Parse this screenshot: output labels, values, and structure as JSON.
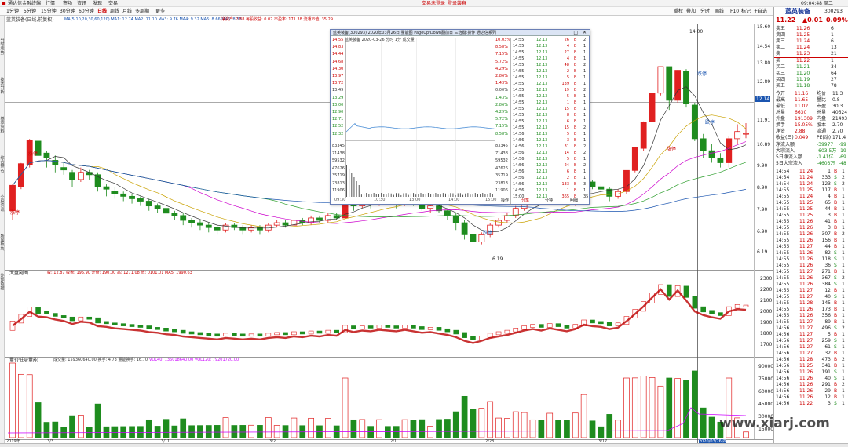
{
  "app": {
    "title": "通达信金融终端",
    "menus": [
      "行情",
      "市场",
      "资讯",
      "发现",
      "交易"
    ],
    "notice": "交易未登录",
    "account": "登录装备",
    "clock": "09:04:48 周二"
  },
  "toolbar": {
    "period_tabs": [
      "1分钟",
      "5分钟",
      "15分钟",
      "30分钟",
      "60分钟",
      "日线",
      "周线",
      "月线",
      "多周期",
      "更多"
    ],
    "active": "日线",
    "right_tabs": [
      "重权",
      "叠加",
      "分时",
      "画线",
      "F10",
      "标记",
      "+自选",
      "返回"
    ]
  },
  "side_tabs": [
    "分时走势",
    "技术分析",
    "基本资料",
    "综合排名",
    "个股资讯",
    "所属板块",
    "外部数据"
  ],
  "chart_header": {
    "name": "蓝英装备(日线,前复权)",
    "ma": "MA(5,10,20,30,60,120) MA1: 12.74 MA2: 11.10 MA3: 9.76 MA4: 9.32 MA5: 8.66 MA6: 8.33",
    "extra": "净资产: 2.88 每股收益: 0.07 市盈率: 171.38 流通市值: 35.29"
  },
  "indicator_header": {
    "name": "大盘副图",
    "vals": "收: 12.87 收盘: 195.90 开盘: 190.00 高: 1271.08 低: 0101.01 MA5: 1990.63"
  },
  "volume_header": {
    "name": "量价低吸量能",
    "vals": "成交量: 159360640.00 换手: 4.73 量能换手: 16.70",
    "ma": "VOL40: 136018640.00 VOL120: 79201720.00"
  },
  "labels": {
    "zt": "涨停",
    "dt": "跌停",
    "high": "14.00",
    "low": "6.19"
  },
  "price_axis": [
    "15.60",
    "14.54",
    "13.80",
    "12.89",
    "11.91",
    "10.89",
    "9.90",
    "8.90",
    "7.90",
    "6.90",
    "6.19"
  ],
  "ind_axis": [
    "2300",
    "2200",
    "2100",
    "2000",
    "1900",
    "1800",
    "1700"
  ],
  "vol_axis": [
    "90000",
    "75000",
    "60000",
    "45000",
    "30000",
    "15000"
  ],
  "date_axis": [
    "2019年",
    "3/3",
    "3/11",
    "3/2",
    "2/1",
    "2/28",
    "3/17",
    "2020/03/26 四"
  ],
  "cursor_price": "12.14",
  "popup": {
    "title": "蓝英装备(300293) 2020年03月26日 量能图 PageUp/Down翻前日 三倍键:操作 通达信系列",
    "sub": "蓝英装备  2020-03-26 分时 1分 成交量",
    "left_scale": [
      "14.55",
      "14.83",
      "14.44",
      "14.68",
      "14.30",
      "13.97",
      "13.72",
      "13.49",
      "13.29",
      "13.00",
      "12.90",
      "12.71",
      "12.52",
      "12.32"
    ],
    "right_scale": [
      "10.03%",
      "8.58%",
      "7.15%",
      "5.72%",
      "4.29%",
      "2.86%",
      "1.43%",
      "0.00%",
      "1.43%",
      "2.86%",
      "4.29%",
      "5.72%",
      "7.15%",
      "8.58%"
    ],
    "vol_scale": [
      "83345",
      "71438",
      "59532",
      "47626",
      "35719",
      "23813",
      "11906"
    ],
    "time_axis": [
      "09:30",
      "10:30",
      "13:00",
      "14:00",
      "15:00"
    ],
    "tabs": [
      "操作",
      "分笔",
      "分钟",
      "明细"
    ],
    "ticks": [
      [
        "14:55",
        "12.13",
        "26",
        "B",
        "2"
      ],
      [
        "14:55",
        "12.13",
        "4",
        "B",
        "1"
      ],
      [
        "14:55",
        "12.13",
        "27",
        "B",
        "1"
      ],
      [
        "14:55",
        "12.13",
        "4",
        "B",
        "1"
      ],
      [
        "14:55",
        "12.13",
        "48",
        "B",
        "2"
      ],
      [
        "14:55",
        "12.13",
        "2",
        "B",
        "1"
      ],
      [
        "14:55",
        "12.13",
        "5",
        "B",
        "1"
      ],
      [
        "14:55",
        "12.13",
        "139",
        "B",
        "1"
      ],
      [
        "14:55",
        "12.13",
        "19",
        "B",
        "2"
      ],
      [
        "14:55",
        "12.13",
        "5",
        "B",
        "1"
      ],
      [
        "14:55",
        "12.13",
        "1",
        "B",
        "1"
      ],
      [
        "14:55",
        "12.13",
        "15",
        "B",
        "1"
      ],
      [
        "14:55",
        "12.13",
        "8",
        "B",
        "1"
      ],
      [
        "14:55",
        "12.13",
        "6",
        "B",
        "1"
      ],
      [
        "14:55",
        "12.13",
        "15",
        "B",
        "2"
      ],
      [
        "14:56",
        "12.13",
        "5",
        "B",
        "1"
      ],
      [
        "14:56",
        "12.13",
        "3",
        "B",
        "1"
      ],
      [
        "14:56",
        "12.13",
        "31",
        "B",
        "2"
      ],
      [
        "14:56",
        "12.13",
        "14",
        "B",
        "2"
      ],
      [
        "14:56",
        "12.13",
        "5",
        "B",
        "1"
      ],
      [
        "14:56",
        "12.13",
        "24",
        "B",
        "2"
      ],
      [
        "14:56",
        "12.13",
        "6",
        "B",
        "1"
      ],
      [
        "14:56",
        "12.13",
        "2",
        "B",
        "1"
      ],
      [
        "14:56",
        "12.13",
        "133",
        "B",
        "3"
      ],
      [
        "14:56",
        "12.13",
        "1",
        "B",
        "1"
      ],
      [
        "15:00",
        "12.13",
        "365",
        "B",
        "35"
      ]
    ]
  },
  "stock": {
    "name": "蓝英装备",
    "code": "300293",
    "price": "11.22",
    "change": "▲0.01",
    "pct": "0.09%",
    "asks": [
      [
        "卖五",
        "11.26",
        "6"
      ],
      [
        "卖四",
        "11.25",
        "1"
      ],
      [
        "卖三",
        "11.24",
        "6"
      ],
      [
        "卖二",
        "11.24",
        "13"
      ],
      [
        "卖一",
        "11.23",
        "21"
      ]
    ],
    "bids": [
      [
        "买一",
        "11.22",
        "1"
      ],
      [
        "买二",
        "11.21",
        "34"
      ],
      [
        "买三",
        "11.20",
        "64"
      ],
      [
        "买四",
        "11.19",
        "27"
      ],
      [
        "买五",
        "11.18",
        "78"
      ]
    ],
    "stats": [
      [
        "今开",
        "11.16",
        "均价",
        "11.3"
      ],
      [
        "最高",
        "11.65",
        "量比",
        "0.8"
      ],
      [
        "最低",
        "11.02",
        "市盈",
        "30.3"
      ],
      [
        "总量",
        "6630",
        "总量",
        "40624"
      ],
      [
        "外盘",
        "191309",
        "内盘",
        "21493"
      ],
      [
        "换手",
        "15.05%",
        "股本",
        "2.70"
      ],
      [
        "净资",
        "2.88",
        "流通",
        "2.70"
      ],
      [
        "收益(三)",
        "0.049",
        "PE(动)",
        "171.4"
      ]
    ],
    "flows": [
      [
        "净流入额",
        "-39977",
        "-99"
      ],
      [
        "大宗流入",
        "-603.5万",
        "-19"
      ],
      [
        "5日净流入额",
        "-1.41亿",
        "-69"
      ],
      [
        "5日大宗流入",
        "-4603万",
        "-48"
      ]
    ]
  },
  "trades": [
    [
      "14:54",
      "11.24",
      "1",
      "B",
      "1"
    ],
    [
      "14:54",
      "11.24",
      "333",
      "S",
      "2"
    ],
    [
      "14:54",
      "11.24",
      "123",
      "S",
      "2"
    ],
    [
      "14:55",
      "11.25",
      "117",
      "B",
      "1"
    ],
    [
      "14:55",
      "11.24",
      "4",
      "B",
      "1"
    ],
    [
      "14:55",
      "11.25",
      "65",
      "B",
      "1"
    ],
    [
      "14:55",
      "11.25",
      "44",
      "B",
      "1"
    ],
    [
      "14:55",
      "11.25",
      "3",
      "B",
      "1"
    ],
    [
      "14:55",
      "11.26",
      "41",
      "B",
      "1"
    ],
    [
      "14:55",
      "11.26",
      "3",
      "B",
      "1"
    ],
    [
      "14:55",
      "11.26",
      "307",
      "B",
      "2"
    ],
    [
      "14:55",
      "11.26",
      "156",
      "B",
      "1"
    ],
    [
      "14:55",
      "11.27",
      "44",
      "B",
      "1"
    ],
    [
      "14:55",
      "11.26",
      "82",
      "S",
      "1"
    ],
    [
      "14:55",
      "11.26",
      "118",
      "S",
      "1"
    ],
    [
      "14:55",
      "11.26",
      "36",
      "S",
      "1"
    ],
    [
      "14:55",
      "11.27",
      "271",
      "B",
      "1"
    ],
    [
      "14:55",
      "11.26",
      "367",
      "S",
      "2"
    ],
    [
      "14:55",
      "11.26",
      "384",
      "S",
      "1"
    ],
    [
      "14:55",
      "11.27",
      "12",
      "B",
      "1"
    ],
    [
      "14:55",
      "11.27",
      "40",
      "S",
      "1"
    ],
    [
      "14:55",
      "11.28",
      "145",
      "B",
      "1"
    ],
    [
      "14:55",
      "11.26",
      "173",
      "B",
      "1"
    ],
    [
      "14:55",
      "11.26",
      "356",
      "B",
      "1"
    ],
    [
      "14:55",
      "11.27",
      "89",
      "B",
      "1"
    ],
    [
      "14:56",
      "11.27",
      "496",
      "S",
      "2"
    ],
    [
      "14:56",
      "11.27",
      "5",
      "B",
      "1"
    ],
    [
      "14:56",
      "11.27",
      "259",
      "S",
      "1"
    ],
    [
      "14:56",
      "11.27",
      "61",
      "S",
      "1"
    ],
    [
      "14:56",
      "11.27",
      "32",
      "B",
      "1"
    ],
    [
      "14:56",
      "11.28",
      "473",
      "B",
      "2"
    ],
    [
      "14:56",
      "11.25",
      "341",
      "B",
      "1"
    ],
    [
      "14:56",
      "11.26",
      "191",
      "S",
      "1"
    ],
    [
      "14:56",
      "11.26",
      "40",
      "S",
      "1"
    ],
    [
      "14:56",
      "11.26",
      "291",
      "B",
      "2"
    ],
    [
      "14:56",
      "11.26",
      "29",
      "B",
      "1"
    ],
    [
      "14:56",
      "11.26",
      "12",
      "B",
      "1"
    ],
    [
      "14:56",
      "11.22",
      "3",
      "S",
      "1"
    ]
  ],
  "watermark": "www.xiarj.com",
  "colors": {
    "up": "#e02020",
    "down": "#1e8c1e",
    "bg": "#ffffff",
    "accent": "#1a3a9a"
  },
  "chart_data": {
    "type": "candlestick",
    "title": "蓝英装备(日线,前复权)",
    "ylim": [
      6,
      15.6
    ],
    "candles": [
      [
        8.0,
        9.06,
        7.6,
        9.1
      ],
      [
        9.0,
        9.96,
        8.9,
        9.99
      ],
      [
        9.9,
        10.95,
        9.8,
        10.99
      ],
      [
        10.9,
        10.3,
        10.1,
        11.2
      ],
      [
        10.4,
        10.2,
        9.8,
        10.5
      ],
      [
        10.1,
        9.9,
        9.6,
        10.3
      ],
      [
        9.8,
        9.7,
        9.5,
        10.0
      ],
      [
        9.6,
        9.3,
        9.0,
        9.7
      ],
      [
        9.3,
        9.6,
        9.2,
        9.8
      ],
      [
        9.6,
        9.5,
        9.3,
        9.7
      ],
      [
        9.5,
        9.0,
        8.8,
        9.6
      ],
      [
        9.0,
        8.9,
        8.6,
        9.1
      ],
      [
        8.8,
        8.7,
        8.5,
        9.0
      ],
      [
        8.7,
        8.6,
        8.4,
        8.8
      ],
      [
        8.6,
        8.5,
        8.3,
        8.7
      ],
      [
        8.5,
        8.4,
        8.2,
        8.6
      ],
      [
        8.4,
        8.2,
        8.0,
        8.5
      ],
      [
        8.2,
        8.1,
        7.9,
        8.3
      ],
      [
        8.1,
        7.9,
        7.7,
        8.2
      ],
      [
        7.9,
        7.8,
        7.6,
        8.0
      ],
      [
        7.8,
        7.6,
        7.4,
        7.9
      ],
      [
        7.6,
        7.5,
        7.3,
        7.7
      ],
      [
        7.5,
        7.4,
        7.2,
        7.6
      ],
      [
        7.4,
        7.3,
        7.1,
        7.5
      ],
      [
        7.3,
        7.2,
        7.0,
        7.4
      ],
      [
        7.2,
        7.4,
        7.1,
        7.5
      ],
      [
        7.4,
        7.3,
        7.2,
        7.5
      ],
      [
        7.3,
        7.2,
        7.0,
        7.4
      ],
      [
        7.2,
        7.3,
        7.1,
        7.4
      ],
      [
        7.3,
        7.2,
        7.0,
        7.4
      ],
      [
        7.2,
        7.4,
        7.1,
        7.5
      ],
      [
        7.4,
        7.5,
        7.3,
        7.6
      ],
      [
        7.5,
        7.4,
        7.3,
        7.6
      ],
      [
        7.4,
        7.6,
        7.3,
        7.7
      ],
      [
        7.6,
        7.5,
        7.4,
        7.7
      ],
      [
        7.5,
        7.7,
        7.4,
        7.8
      ],
      [
        7.7,
        7.6,
        7.5,
        7.8
      ],
      [
        7.6,
        7.8,
        7.5,
        7.9
      ],
      [
        7.8,
        7.7,
        7.6,
        7.9
      ],
      [
        7.7,
        8.47,
        7.6,
        8.47
      ],
      [
        8.4,
        8.2,
        8.0,
        8.6
      ],
      [
        8.2,
        8.4,
        8.1,
        8.5
      ],
      [
        8.4,
        8.3,
        8.1,
        8.5
      ],
      [
        8.3,
        8.5,
        8.2,
        8.6
      ],
      [
        8.5,
        8.4,
        8.3,
        8.6
      ],
      [
        8.4,
        8.3,
        8.1,
        8.5
      ],
      [
        8.3,
        8.5,
        8.2,
        8.6
      ],
      [
        8.5,
        8.3,
        8.2,
        8.6
      ],
      [
        8.3,
        8.1,
        8.0,
        8.4
      ],
      [
        8.1,
        8.2,
        7.9,
        8.3
      ],
      [
        8.2,
        8.0,
        7.9,
        8.3
      ],
      [
        8.0,
        7.8,
        7.6,
        8.1
      ],
      [
        7.8,
        7.5,
        7.2,
        7.9
      ],
      [
        7.5,
        7.0,
        6.8,
        7.6
      ],
      [
        7.0,
        6.7,
        6.19,
        7.1
      ],
      [
        6.7,
        7.0,
        6.6,
        7.1
      ],
      [
        7.0,
        7.4,
        6.9,
        7.5
      ],
      [
        7.4,
        7.6,
        7.3,
        7.7
      ],
      [
        7.6,
        7.8,
        7.5,
        7.9
      ],
      [
        7.8,
        8.1,
        7.7,
        8.2
      ],
      [
        8.1,
        8.4,
        8.0,
        8.5
      ],
      [
        8.4,
        8.6,
        8.3,
        8.7
      ],
      [
        8.6,
        8.4,
        8.3,
        8.7
      ],
      [
        8.4,
        8.7,
        8.3,
        8.8
      ],
      [
        8.7,
        8.5,
        8.4,
        8.8
      ],
      [
        8.5,
        8.3,
        8.2,
        8.6
      ],
      [
        8.3,
        8.6,
        8.2,
        8.7
      ],
      [
        8.6,
        9.2,
        8.5,
        9.3
      ],
      [
        9.2,
        9.0,
        8.9,
        9.3
      ],
      [
        9.0,
        8.9,
        8.7,
        9.1
      ],
      [
        8.9,
        8.6,
        8.4,
        9.0
      ],
      [
        8.6,
        8.8,
        8.5,
        8.9
      ],
      [
        8.8,
        9.68,
        8.7,
        9.68
      ],
      [
        9.68,
        10.65,
        9.6,
        10.65
      ],
      [
        10.6,
        11.7,
        10.5,
        11.72
      ],
      [
        11.7,
        12.88,
        11.6,
        12.88
      ],
      [
        12.9,
        14.0,
        12.8,
        14.0
      ],
      [
        14.0,
        12.6,
        12.2,
        14.0
      ],
      [
        12.6,
        13.85,
        12.5,
        13.86
      ],
      [
        13.8,
        12.47,
        12.3,
        13.9
      ],
      [
        12.4,
        11.0,
        10.9,
        12.5
      ],
      [
        11.0,
        10.5,
        10.2,
        11.2
      ],
      [
        10.5,
        10.2,
        10.0,
        10.8
      ],
      [
        10.2,
        10.0,
        9.8,
        10.4
      ],
      [
        10.0,
        11.0,
        9.8,
        11.1
      ],
      [
        11.0,
        11.3,
        10.8,
        11.6
      ],
      [
        11.2,
        11.22,
        11.02,
        11.65
      ]
    ]
  }
}
